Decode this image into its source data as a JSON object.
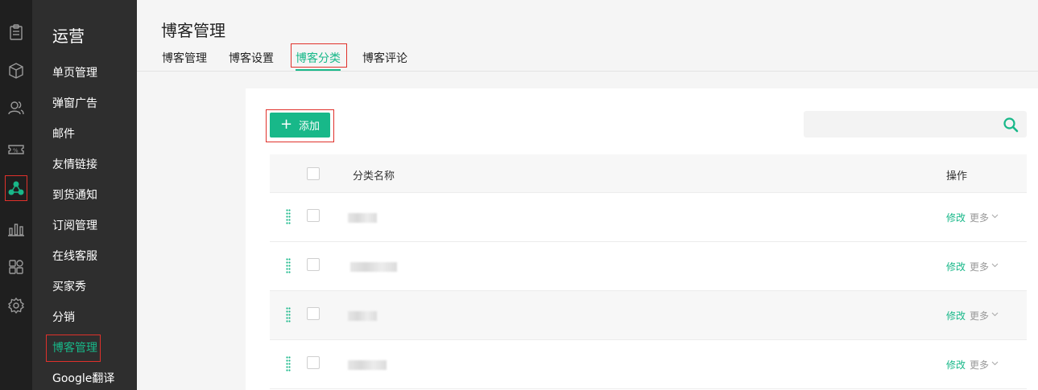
{
  "rail": {
    "icons": [
      "clipboard-icon",
      "box-icon",
      "users-icon",
      "coupon-icon",
      "marketing-icon",
      "chart-icon",
      "apps-icon",
      "gear-icon"
    ]
  },
  "menu": {
    "title": "运营",
    "items": [
      {
        "label": "单页管理"
      },
      {
        "label": "弹窗广告"
      },
      {
        "label": "邮件"
      },
      {
        "label": "友情链接"
      },
      {
        "label": "到货通知"
      },
      {
        "label": "订阅管理"
      },
      {
        "label": "在线客服"
      },
      {
        "label": "买家秀"
      },
      {
        "label": "分销"
      },
      {
        "label": "博客管理"
      },
      {
        "label": "Google翻译"
      }
    ]
  },
  "header": {
    "title": "博客管理",
    "tabs": [
      {
        "label": "博客管理"
      },
      {
        "label": "博客设置"
      },
      {
        "label": "博客分类"
      },
      {
        "label": "博客评论"
      }
    ]
  },
  "toolbar": {
    "add_label": "添加",
    "search_value": ""
  },
  "table": {
    "columns": {
      "name": "分类名称",
      "ops": "操作"
    },
    "rows": [
      {
        "edit": "修改",
        "more": "更多"
      },
      {
        "edit": "修改",
        "more": "更多"
      },
      {
        "edit": "修改",
        "more": "更多"
      },
      {
        "edit": "修改",
        "more": "更多"
      }
    ]
  },
  "colors": {
    "accent": "#18b889",
    "highlight_border": "#e0312b",
    "rail_bg": "#1f1f1f",
    "menu_bg": "#2e2e2e"
  }
}
